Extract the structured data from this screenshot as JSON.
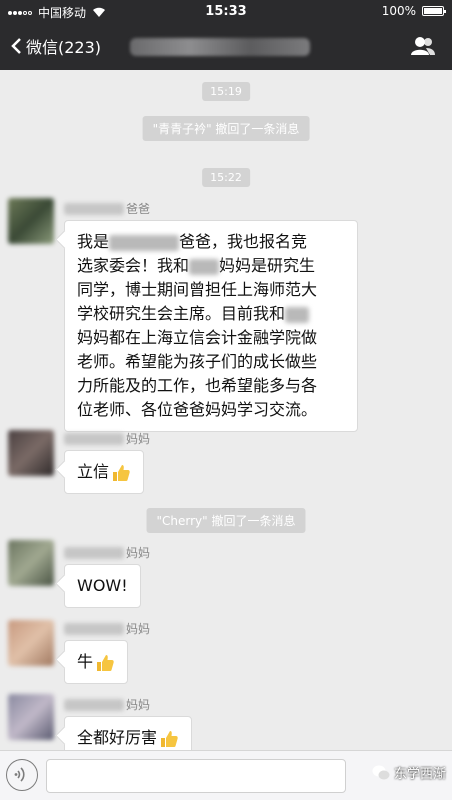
{
  "status_bar": {
    "carrier": "中国移动",
    "time": "15:33",
    "battery": "100%"
  },
  "nav": {
    "back_label": "微信(223)"
  },
  "timestamps": [
    "15:19",
    "15:22"
  ],
  "system_messages": [
    "\"青青子衿\" 撤回了一条消息",
    "\"Cherry\" 撤回了一条消息"
  ],
  "messages": [
    {
      "sender_suffix": "爸爸",
      "lines": [
        [
          "我是",
          "",
          "爸爸，我也报名竞"
        ],
        [
          "选家委会！我和",
          "",
          "妈妈是研究生"
        ],
        [
          "同学，博士期间曾担任上海师范大"
        ],
        [
          "学校研究生会主席。目前我和",
          ""
        ],
        [
          "妈妈都在上海立信会计金融学院做"
        ],
        [
          "老师。希望能为孩子们的成长做些"
        ],
        [
          "力所能及的工作，也希望能多与各"
        ],
        [
          "位老师、各位爸爸妈妈学习交流。"
        ]
      ]
    },
    {
      "sender_suffix": "妈妈",
      "text": "立信"
    },
    {
      "sender_suffix": "妈妈",
      "text": "WOW!"
    },
    {
      "sender_suffix": "妈妈",
      "text": "牛"
    },
    {
      "sender_suffix": "妈妈",
      "text": "全都好厉害"
    }
  ],
  "watermark": "东学西渐",
  "icons": [
    "wifi-icon",
    "battery-icon",
    "back-chevron-icon",
    "contacts-icon",
    "thumbs-up-icon",
    "voice-icon"
  ],
  "colors": {
    "nav_bg": "#2b2b2d",
    "chat_bg": "#ececec",
    "bubble_bg": "#ffffff"
  }
}
